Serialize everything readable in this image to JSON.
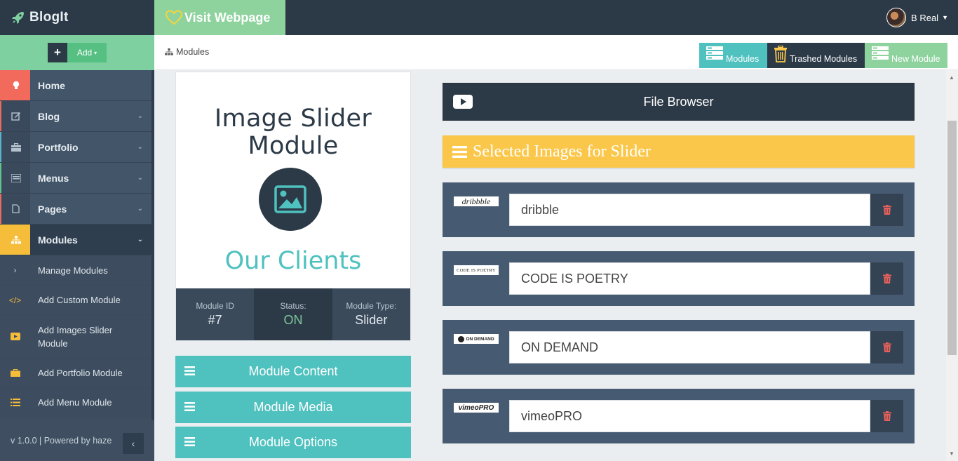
{
  "app": {
    "name": "BlogIt"
  },
  "add_bar": {
    "plus": "+",
    "add_label": "Add",
    "caret": "▾"
  },
  "nav": {
    "items": [
      {
        "label": "Home",
        "icon": "bulb-icon"
      },
      {
        "label": "Blog",
        "icon": "edit-icon"
      },
      {
        "label": "Portfolio",
        "icon": "briefcase-icon"
      },
      {
        "label": "Menus",
        "icon": "menu-list-icon"
      },
      {
        "label": "Pages",
        "icon": "file-icon"
      },
      {
        "label": "Modules",
        "icon": "sitemap-icon"
      }
    ],
    "sub_items": [
      {
        "label": "Manage Modules",
        "icon": "chevron-right-icon"
      },
      {
        "label": "Add Custom Module",
        "icon": "code-icon"
      },
      {
        "label": "Add Images Slider Module",
        "icon": "play-icon"
      },
      {
        "label": "Add Portfolio Module",
        "icon": "briefcase-icon"
      },
      {
        "label": "Add Menu Module",
        "icon": "list-icon"
      }
    ]
  },
  "footer": {
    "version": "v 1.0.0 | Powered by haze",
    "collapse": "‹"
  },
  "topbar": {
    "visit_label": "Visit Webpage",
    "user_name": "B Real"
  },
  "breadcrumb": {
    "current": "Modules"
  },
  "toolbar": {
    "modules_label": "Modules",
    "trashed_label": "Trashed Modules",
    "new_label": "New Module"
  },
  "module_card": {
    "title": "Image Slider Module",
    "subtitle": "Our Clients",
    "stats": [
      {
        "label": "Module ID",
        "value": "#7"
      },
      {
        "label": "Status:",
        "value": "ON"
      },
      {
        "label": "Module Type:",
        "value": "Slider"
      }
    ]
  },
  "accordion": {
    "content_label": "Module Content",
    "media_label": "Module Media",
    "options_label": "Module Options"
  },
  "file_browser": {
    "label": "File Browser"
  },
  "selected_images": {
    "heading": "Selected Images for Slider",
    "items": [
      {
        "thumb_text": "dribbble",
        "value": "dribble"
      },
      {
        "thumb_text": "CODE IS POETRY",
        "value": "CODE IS POETRY"
      },
      {
        "thumb_text": "ON DEMAND",
        "value": "ON DEMAND"
      },
      {
        "thumb_text": "vimeoPRO",
        "value": "vimeoPRO"
      }
    ]
  },
  "colors": {
    "sidebar": "#3f4f61",
    "topbar": "#2c3a48",
    "green": "#8ed39e",
    "teal": "#4fc1bf",
    "yellow": "#fac74a",
    "red": "#f26a5c",
    "row_bg": "#465a71"
  }
}
